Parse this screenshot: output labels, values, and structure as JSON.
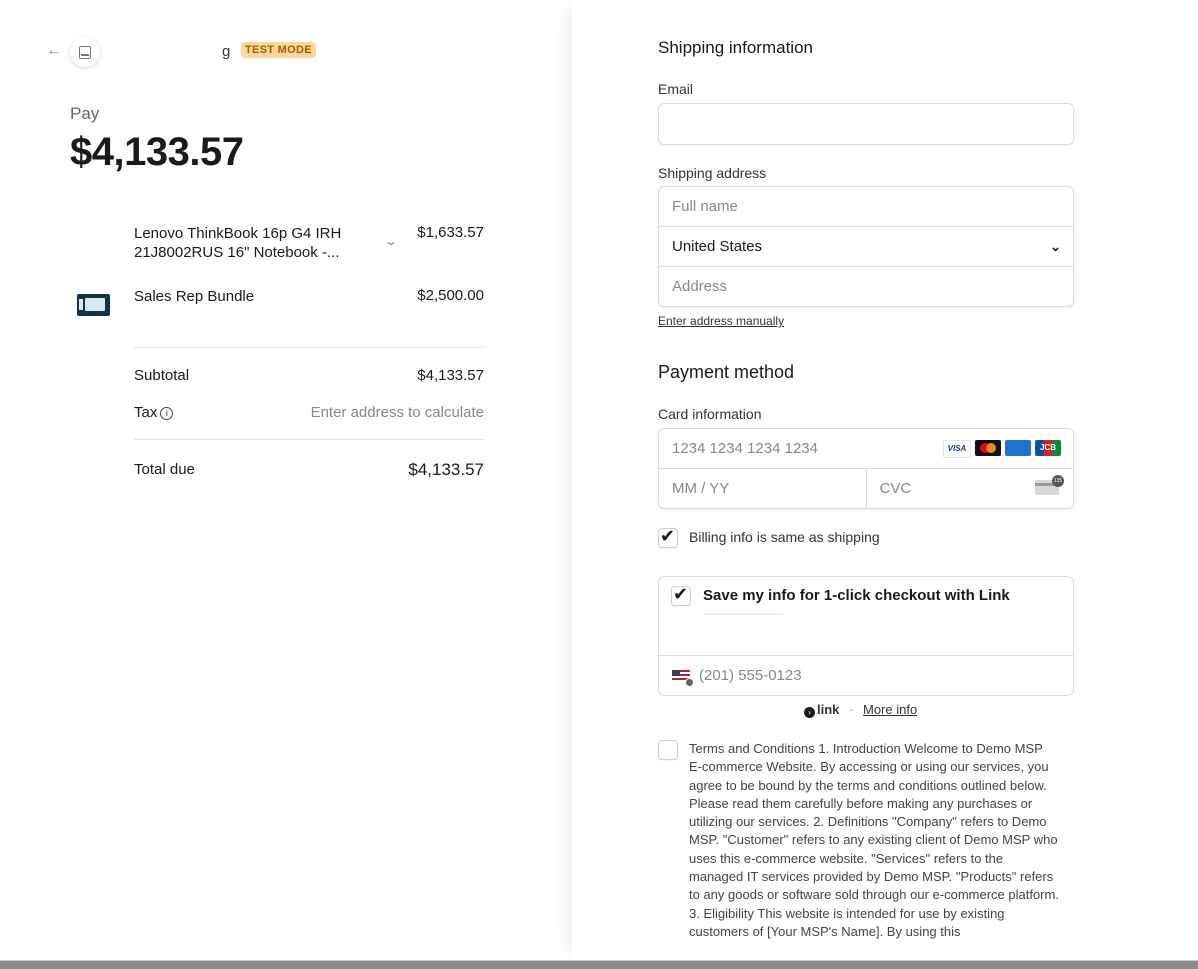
{
  "header": {
    "merchant_name": "g",
    "test_badge": "TEST MODE"
  },
  "summary": {
    "pay_label": "Pay",
    "pay_amount": "$4,133.57",
    "items": [
      {
        "name": "Lenovo ThinkBook 16p G4 IRH 21J8002RUS 16\" Notebook -...",
        "price": "$1,633.57"
      },
      {
        "name": "Sales Rep Bundle",
        "price": "$2,500.00"
      }
    ],
    "subtotal_label": "Subtotal",
    "subtotal_value": "$4,133.57",
    "tax_label": "Tax",
    "tax_value": "Enter address to calculate",
    "total_label": "Total due",
    "total_value": "$4,133.57"
  },
  "shipping": {
    "title": "Shipping information",
    "email_label": "Email",
    "email_value": "",
    "address_label": "Shipping address",
    "full_name_placeholder": "Full name",
    "country": "United States",
    "address_placeholder": "Address",
    "enter_manually": "Enter address manually"
  },
  "payment": {
    "title": "Payment method",
    "card_label": "Card information",
    "card_number_placeholder": "1234 1234 1234 1234",
    "expiry_placeholder": "MM / YY",
    "cvc_placeholder": "CVC",
    "brands": [
      "VISA",
      "",
      "",
      "JCB"
    ],
    "billing_same": "Billing info is same as shipping"
  },
  "link": {
    "save_label": "Save my info for 1-click checkout with Link",
    "phone_placeholder": "(201) 555-0123",
    "logo_text": "link",
    "separator": "·",
    "more_info": "More info"
  },
  "terms": {
    "text": "Terms and Conditions 1. Introduction Welcome to Demo MSP E-commerce Website. By accessing or using our services, you agree to be bound by the terms and conditions outlined below. Please read them carefully before making any purchases or utilizing our services. 2. Definitions \"Company\" refers to Demo MSP. \"Customer\" refers to any existing client of Demo MSP who uses this e-commerce website. \"Services\" refers to the managed IT services provided by Demo MSP. \"Products\" refers to any goods or software sold through our e-commerce platform. 3. Eligibility This website is intended for use by existing customers of [Your MSP's Name]. By using this"
  }
}
